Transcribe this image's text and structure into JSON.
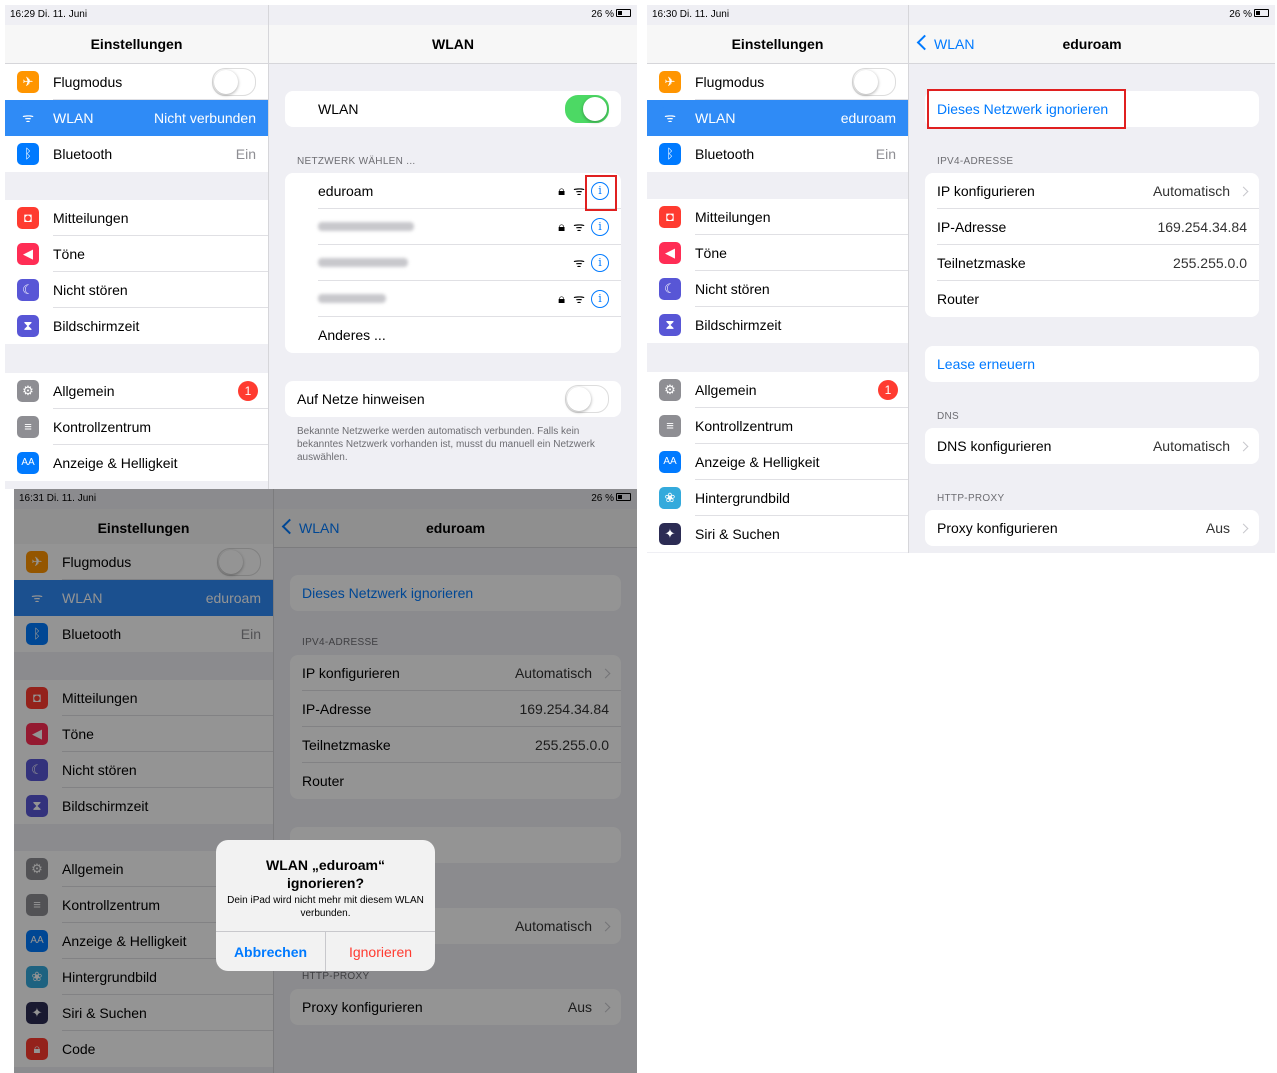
{
  "colors": {
    "accent": "#007aff",
    "selected_row": "#2f8bf6",
    "toggle_on": "#4cd964",
    "badge": "#ff3b30",
    "destructive": "#ff3b30",
    "highlight_box": "#e02020"
  },
  "s1": {
    "status": {
      "time_date": "16:29  Di. 11. Juni",
      "battery": "26 %"
    },
    "sidebar": {
      "title": "Einstellungen",
      "items": [
        {
          "label": "Flugmodus",
          "icon": "airplane-icon",
          "value": ""
        },
        {
          "label": "WLAN",
          "icon": "wifi-icon",
          "value": "Nicht verbunden"
        },
        {
          "label": "Bluetooth",
          "icon": "bluetooth-icon",
          "value": "Ein"
        },
        {
          "label": "Mitteilungen",
          "icon": "notifications-icon",
          "value": ""
        },
        {
          "label": "Töne",
          "icon": "speaker-icon",
          "value": ""
        },
        {
          "label": "Nicht stören",
          "icon": "moon-icon",
          "value": ""
        },
        {
          "label": "Bildschirmzeit",
          "icon": "hourglass-icon",
          "value": ""
        },
        {
          "label": "Allgemein",
          "icon": "gear-icon",
          "value": "1"
        },
        {
          "label": "Kontrollzentrum",
          "icon": "control-center-icon",
          "value": ""
        },
        {
          "label": "Anzeige & Helligkeit",
          "icon": "display-icon",
          "value": "AA"
        }
      ]
    },
    "main": {
      "title": "WLAN",
      "wlan_label": "WLAN",
      "toggle_on": true,
      "choose_header": "NETZWERK WÄHLEN ...",
      "networks": [
        {
          "name": "eduroam"
        },
        {
          "name": "RWTH-devices"
        },
        {
          "name": "RWTH-guests"
        },
        {
          "name": "skynet 2.4"
        }
      ],
      "other": "Anderes ...",
      "ask_label": "Auf Netze hinweisen",
      "ask_on": false,
      "footer": "Bekannte Netzwerke werden automatisch verbunden. Falls kein bekanntes Netzwerk vorhanden ist, musst du manuell ein Netzwerk auswählen."
    }
  },
  "s2": {
    "status": {
      "time_date": "16:30  Di. 11. Juni",
      "battery": "26 %"
    },
    "sidebar": {
      "title": "Einstellungen",
      "items": [
        {
          "label": "Flugmodus",
          "value": ""
        },
        {
          "label": "WLAN",
          "value": "eduroam"
        },
        {
          "label": "Bluetooth",
          "value": "Ein"
        },
        {
          "label": "Mitteilungen",
          "value": ""
        },
        {
          "label": "Töne",
          "value": ""
        },
        {
          "label": "Nicht stören",
          "value": ""
        },
        {
          "label": "Bildschirmzeit",
          "value": ""
        },
        {
          "label": "Allgemein",
          "value": "1"
        },
        {
          "label": "Kontrollzentrum",
          "value": ""
        },
        {
          "label": "Anzeige & Helligkeit",
          "value": ""
        },
        {
          "label": "Hintergrundbild",
          "value": ""
        },
        {
          "label": "Siri & Suchen",
          "value": ""
        }
      ]
    },
    "main": {
      "back": "WLAN",
      "title": "eduroam",
      "forget": "Dieses Netzwerk ignorieren",
      "ipv4_header": "IPV4-ADRESSE",
      "ip_config_label": "IP konfigurieren",
      "ip_config_value": "Automatisch",
      "ip_label": "IP-Adresse",
      "ip_value": "169.254.34.84",
      "mask_label": "Teilnetzmaske",
      "mask_value": "255.255.0.0",
      "router_label": "Router",
      "renew": "Lease erneuern",
      "dns_header": "DNS",
      "dns_label": "DNS konfigurieren",
      "dns_value": "Automatisch",
      "proxy_header": "HTTP-PROXY",
      "proxy_label": "Proxy konfigurieren",
      "proxy_value": "Aus"
    }
  },
  "s3": {
    "status": {
      "time_date": "16:31  Di. 11. Juni",
      "battery": "26 %"
    },
    "sidebar": {
      "title": "Einstellungen",
      "items": [
        {
          "label": "Flugmodus",
          "value": ""
        },
        {
          "label": "WLAN",
          "value": "eduroam"
        },
        {
          "label": "Bluetooth",
          "value": "Ein"
        },
        {
          "label": "Mitteilungen",
          "value": ""
        },
        {
          "label": "Töne",
          "value": ""
        },
        {
          "label": "Nicht stören",
          "value": ""
        },
        {
          "label": "Bildschirmzeit",
          "value": ""
        },
        {
          "label": "Allgemein",
          "value": ""
        },
        {
          "label": "Kontrollzentrum",
          "value": ""
        },
        {
          "label": "Anzeige & Helligkeit",
          "value": ""
        },
        {
          "label": "Hintergrundbild",
          "value": ""
        },
        {
          "label": "Siri & Suchen",
          "value": ""
        },
        {
          "label": "Code",
          "value": ""
        }
      ]
    },
    "main": {
      "back": "WLAN",
      "title": "eduroam",
      "forget": "Dieses Netzwerk ignorieren",
      "ipv4_header": "IPV4-ADRESSE",
      "ip_config_label": "IP konfigurieren",
      "ip_config_value": "Automatisch",
      "ip_label": "IP-Adresse",
      "ip_value": "169.254.34.84",
      "mask_label": "Teilnetzmaske",
      "mask_value": "255.255.0.0",
      "router_label": "Router",
      "dns_value": "Automatisch",
      "proxy_header": "HTTP-PROXY",
      "proxy_label": "Proxy konfigurieren",
      "proxy_value": "Aus"
    },
    "alert": {
      "title": "WLAN „eduroam“ ignorieren?",
      "message": "Dein iPad wird nicht mehr mit diesem WLAN verbunden.",
      "cancel": "Abbrechen",
      "confirm": "Ignorieren"
    }
  }
}
